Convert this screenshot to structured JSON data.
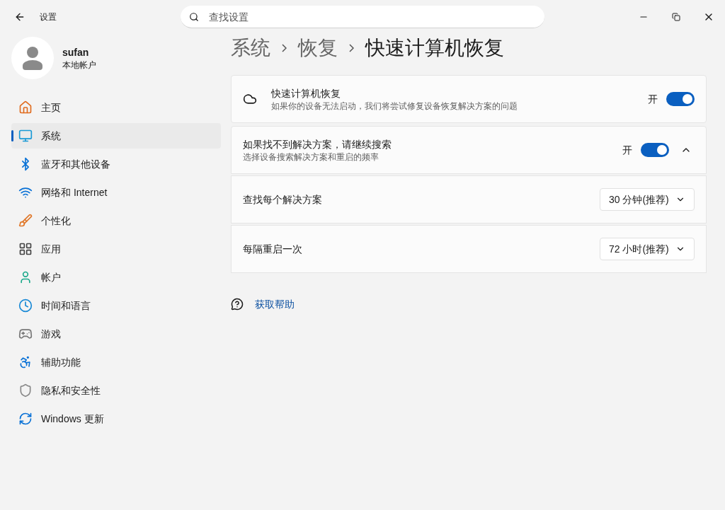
{
  "window": {
    "title": "设置"
  },
  "search": {
    "placeholder": "查找设置"
  },
  "user": {
    "name": "sufan",
    "account_type": "本地帐户"
  },
  "nav": [
    {
      "label": "主页",
      "selected": false
    },
    {
      "label": "系统",
      "selected": true
    },
    {
      "label": "蓝牙和其他设备",
      "selected": false
    },
    {
      "label": "网络和 Internet",
      "selected": false
    },
    {
      "label": "个性化",
      "selected": false
    },
    {
      "label": "应用",
      "selected": false
    },
    {
      "label": "帐户",
      "selected": false
    },
    {
      "label": "时间和语言",
      "selected": false
    },
    {
      "label": "游戏",
      "selected": false
    },
    {
      "label": "辅助功能",
      "selected": false
    },
    {
      "label": "隐私和安全性",
      "selected": false
    },
    {
      "label": "Windows 更新",
      "selected": false
    }
  ],
  "breadcrumb": [
    "系统",
    "恢复",
    "快速计算机恢复"
  ],
  "main_setting": {
    "title": "快速计算机恢复",
    "description": "如果你的设备无法启动，我们将尝试修复设备恢复解决方案的问题",
    "toggle_label": "开",
    "on": true
  },
  "search_setting": {
    "title": "如果找不到解决方案，请继续搜索",
    "description": "选择设备搜索解决方案和重启的频率",
    "toggle_label": "开",
    "on": true,
    "expanded": true,
    "rows": [
      {
        "label": "查找每个解决方案",
        "value": "30 分钟(推荐)"
      },
      {
        "label": "每隔重启一次",
        "value": "72 小时(推荐)"
      }
    ]
  },
  "help_link": "获取帮助"
}
